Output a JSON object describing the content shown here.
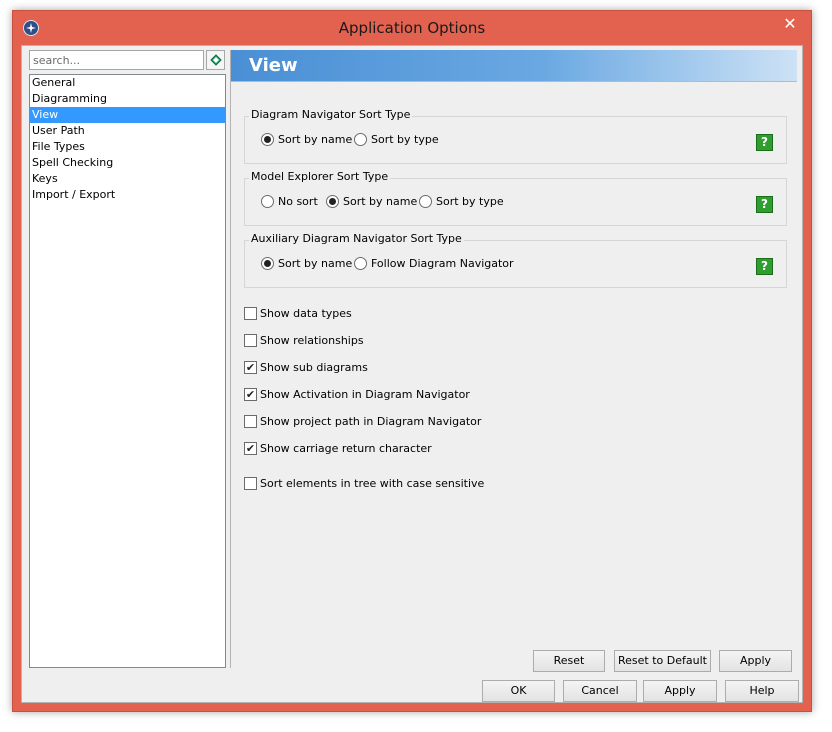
{
  "window": {
    "title": "Application Options",
    "close_glyph": "✕",
    "app_icon": "app-logo-icon"
  },
  "sidebar": {
    "search": {
      "placeholder": "search..."
    },
    "items": [
      {
        "label": "General",
        "selected": false
      },
      {
        "label": "Diagramming",
        "selected": false
      },
      {
        "label": "View",
        "selected": true
      },
      {
        "label": "User Path",
        "selected": false
      },
      {
        "label": "File Types",
        "selected": false
      },
      {
        "label": "Spell Checking",
        "selected": false
      },
      {
        "label": "Keys",
        "selected": false
      },
      {
        "label": "Import / Export",
        "selected": false
      }
    ]
  },
  "panel": {
    "title": "View",
    "groups": [
      {
        "title": "Diagram Navigator Sort Type",
        "options": [
          {
            "label": "Sort by name",
            "selected": true
          },
          {
            "label": "Sort by type",
            "selected": false
          }
        ]
      },
      {
        "title": "Model Explorer Sort Type",
        "options": [
          {
            "label": "No sort",
            "selected": false
          },
          {
            "label": "Sort by name",
            "selected": true
          },
          {
            "label": "Sort by type",
            "selected": false
          }
        ]
      },
      {
        "title": "Auxiliary Diagram Navigator Sort Type",
        "options": [
          {
            "label": "Sort by name",
            "selected": true
          },
          {
            "label": "Follow Diagram Navigator",
            "selected": false
          }
        ]
      }
    ],
    "help_label": "?",
    "checkboxes": [
      {
        "label": "Show data types",
        "checked": false
      },
      {
        "label": "Show relationships",
        "checked": false
      },
      {
        "label": "Show sub diagrams",
        "checked": true
      },
      {
        "label": "Show Activation in Diagram Navigator",
        "checked": true
      },
      {
        "label": "Show project path in Diagram Navigator",
        "checked": false
      },
      {
        "label": "Show carriage return character",
        "checked": true
      },
      {
        "label": "Sort elements in tree with case sensitive",
        "checked": false
      }
    ],
    "buttons": {
      "reset": "Reset",
      "reset_default": "Reset to Default",
      "apply": "Apply"
    }
  },
  "footer": {
    "ok": "OK",
    "cancel": "Cancel",
    "apply": "Apply",
    "help": "Help"
  },
  "colors": {
    "titlebar": "#e2614f",
    "selection": "#3399ff",
    "header_start": "#4a8fd5",
    "help_green": "#2e9e2e"
  }
}
